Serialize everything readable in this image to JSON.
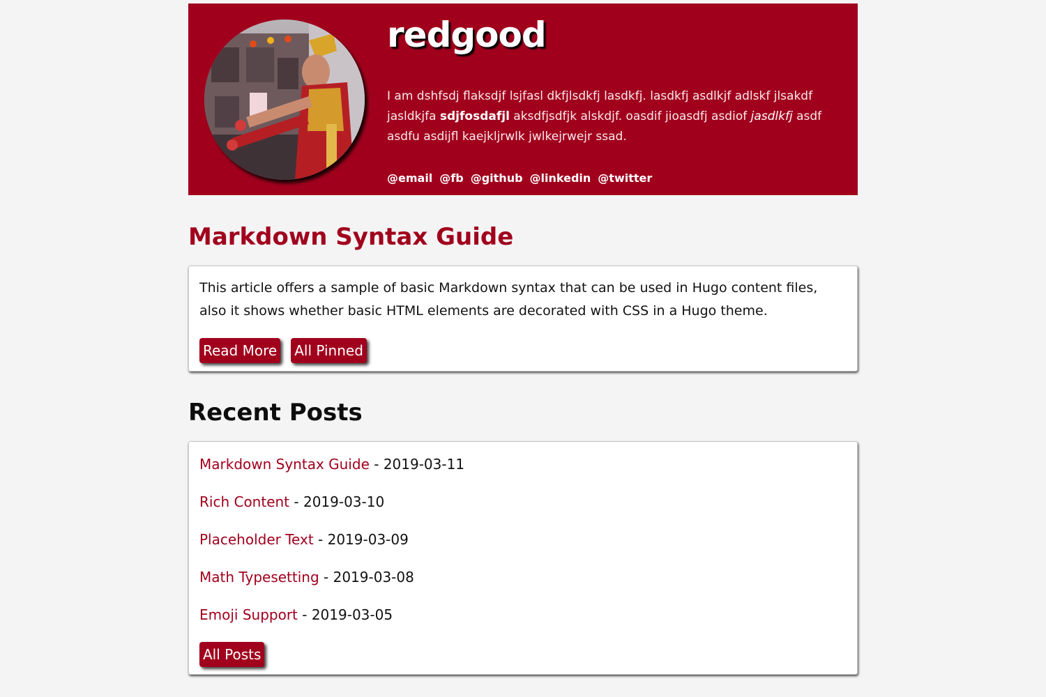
{
  "header": {
    "site_title": "redgood",
    "bio": {
      "part1": "I am dshfsdj flaksdjf lsjfasl dkfjlsdkfj lasdkfj. lasdkfj asdlkjf adlskf jlsakdf jasldkjfa ",
      "bold": "sdjfosdafjl",
      "part2": " aksdfjsdfjk alskdjf. oasdif jioasdfj asdiof ",
      "italic": "jasdlkfj",
      "part3": " asdf asdfu asdijfl kaejkljrwlk jwlkejrwejr ssad."
    },
    "social": [
      "@email",
      "@fb",
      "@github",
      "@linkedin",
      "@twitter"
    ]
  },
  "pinned": {
    "title": "Markdown Syntax Guide",
    "summary": "This article offers a sample of basic Markdown syntax that can be used in Hugo content files, also it shows whether basic HTML elements are decorated with CSS in a Hugo theme.",
    "read_more_label": "Read More",
    "all_pinned_label": "All Pinned"
  },
  "recent": {
    "title": "Recent Posts",
    "separator": " - ",
    "posts": [
      {
        "title": "Markdown Syntax Guide",
        "date": "2019-03-11"
      },
      {
        "title": "Rich Content",
        "date": "2019-03-10"
      },
      {
        "title": "Placeholder Text",
        "date": "2019-03-09"
      },
      {
        "title": "Math Typesetting",
        "date": "2019-03-08"
      },
      {
        "title": "Emoji Support",
        "date": "2019-03-05"
      }
    ],
    "all_posts_label": "All Posts"
  },
  "colors": {
    "accent": "#a1001d",
    "background": "#f4f4f4",
    "card": "#ffffff"
  }
}
